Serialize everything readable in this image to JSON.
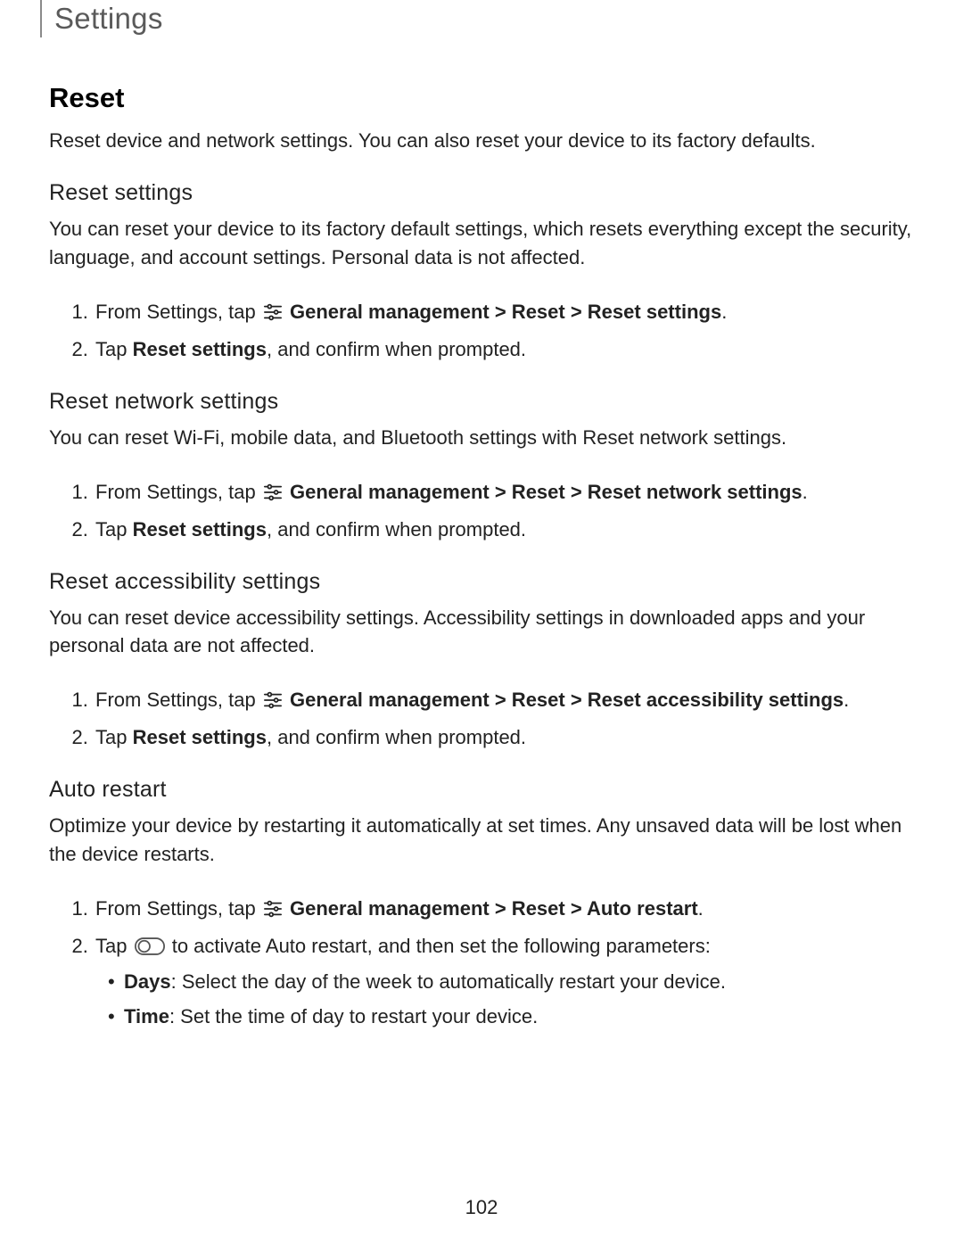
{
  "header": {
    "title": "Settings"
  },
  "footer": {
    "page_number": "102"
  },
  "section": {
    "title": "Reset",
    "intro": "Reset device and network settings. You can also reset your device to its factory defaults."
  },
  "reset_settings": {
    "heading": "Reset settings",
    "body": "You can reset your device to its factory default settings, which resets everything except the security, language, and account settings. Personal data is not affected.",
    "step1_pre": "From Settings, tap ",
    "step1_bold": "General management > Reset > Reset settings",
    "step1_post": ".",
    "step2_pre": "Tap ",
    "step2_bold": "Reset settings",
    "step2_post": ", and confirm when prompted."
  },
  "reset_network": {
    "heading": "Reset network settings",
    "body": "You can reset Wi-Fi, mobile data, and Bluetooth settings with Reset network settings.",
    "step1_pre": "From Settings, tap ",
    "step1_bold": "General management > Reset > Reset network settings",
    "step1_post": ".",
    "step2_pre": "Tap ",
    "step2_bold": "Reset settings",
    "step2_post": ", and confirm when prompted."
  },
  "reset_accessibility": {
    "heading": "Reset accessibility settings",
    "body": "You can reset device accessibility settings. Accessibility settings in downloaded apps and your personal data are not affected.",
    "step1_pre": "From Settings, tap ",
    "step1_bold": "General management > Reset > Reset accessibility settings",
    "step1_post": ".",
    "step2_pre": "Tap ",
    "step2_bold": "Reset settings",
    "step2_post": ", and confirm when prompted."
  },
  "auto_restart": {
    "heading": "Auto restart",
    "body": "Optimize your device by restarting it automatically at set times. Any unsaved data will be lost when the device restarts.",
    "step1_pre": "From Settings, tap ",
    "step1_bold": "General management > Reset > Auto restart",
    "step1_post": ".",
    "step2_pre": "Tap ",
    "step2_post": " to activate Auto restart, and then set the following parameters:",
    "days_label": "Days",
    "days_text": ": Select the day of the week to automatically restart your device.",
    "time_label": "Time",
    "time_text": ": Set the time of day to restart your device."
  }
}
